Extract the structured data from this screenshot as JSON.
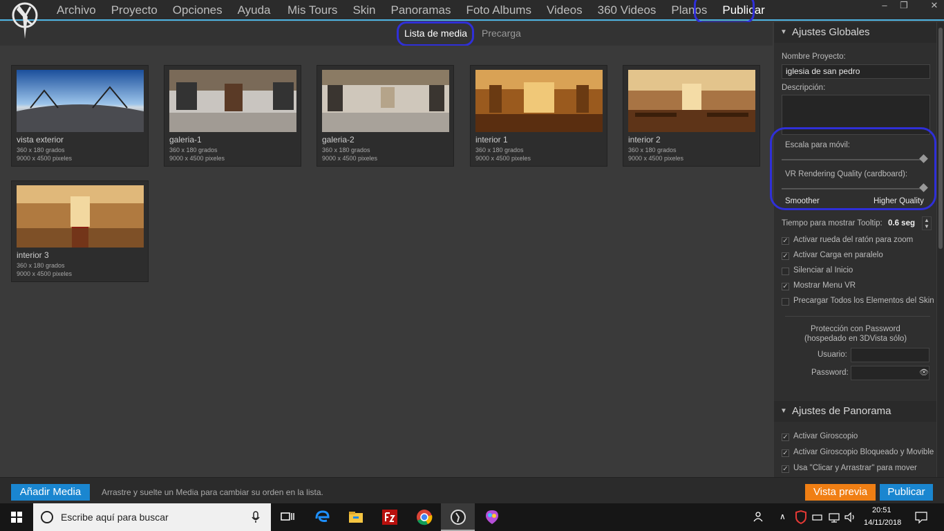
{
  "menu": {
    "left": [
      "Archivo",
      "Proyecto",
      "Opciones",
      "Ayuda"
    ],
    "right": [
      "Mis Tours",
      "Skin",
      "Panoramas",
      "Foto Albums",
      "Videos",
      "360 Videos",
      "Planos",
      "Publicar"
    ]
  },
  "window": {
    "minimize": "–",
    "maximize": "❐",
    "close": "✕"
  },
  "tabs": {
    "media": "Lista de media",
    "preload": "Precarga"
  },
  "media": [
    {
      "name": "vista exterior",
      "dims": "360 x 180 grados",
      "pixels": "9000 x 4500 pixeles"
    },
    {
      "name": "galeria-1",
      "dims": "360 x 180 grados",
      "pixels": "9000 x 4500 pixeles"
    },
    {
      "name": "galeria-2",
      "dims": "360 x 180 grados",
      "pixels": "9000 x 4500 pixeles"
    },
    {
      "name": "interior 1",
      "dims": "360 x 180 grados",
      "pixels": "9000 x 4500 pixeles"
    },
    {
      "name": "interior 2",
      "dims": "360 x 180 grados",
      "pixels": "9000 x 4500 pixeles"
    },
    {
      "name": "interior 3",
      "dims": "360 x 180 grados",
      "pixels": "9000 x 4500 pixeles"
    }
  ],
  "panel": {
    "global_title": "Ajustes Globales",
    "project_name_label": "Nombre Proyecto:",
    "project_name": "iglesia de san pedro",
    "description_label": "Descripción:",
    "mobile_scale_label": "Escala para móvil:",
    "vr_quality_label": "VR Rendering Quality (cardboard):",
    "smoother": "Smoother",
    "higher_quality": "Higher Quality",
    "tooltip_label": "Tiempo para mostrar Tooltip:",
    "tooltip_value": "0.6 seg",
    "checks": [
      {
        "label": "Activar rueda del ratón para zoom",
        "checked": true
      },
      {
        "label": "Activar Carga en paralelo",
        "checked": true
      },
      {
        "label": "Silenciar al Inicio",
        "checked": false
      },
      {
        "label": "Mostrar Menu VR",
        "checked": true
      },
      {
        "label": "Precargar Todos los Elementos del Skin",
        "checked": false
      }
    ],
    "password_title_1": "Protección con Password",
    "password_title_2": "(hospedado en 3DVista sólo)",
    "user_label": "Usuario:",
    "password_label": "Password:",
    "pano_title": "Ajustes de Panorama",
    "pano_checks": [
      {
        "label": "Activar Giroscopio",
        "checked": true
      },
      {
        "label": "Activar Giroscopio Bloqueado y Movible",
        "checked": true
      },
      {
        "label": "Usa \"Clicar y Arrastrar\" para mover",
        "checked": true
      }
    ]
  },
  "bottom": {
    "add_media": "Añadir Media",
    "hint": "Arrastre y suelte un Media para cambiar su orden en la lista.",
    "preview": "Vista previa",
    "publish": "Publicar"
  },
  "taskbar": {
    "search_placeholder": "Escribe aquí para buscar",
    "time": "20:51",
    "date": "14/11/2018"
  }
}
